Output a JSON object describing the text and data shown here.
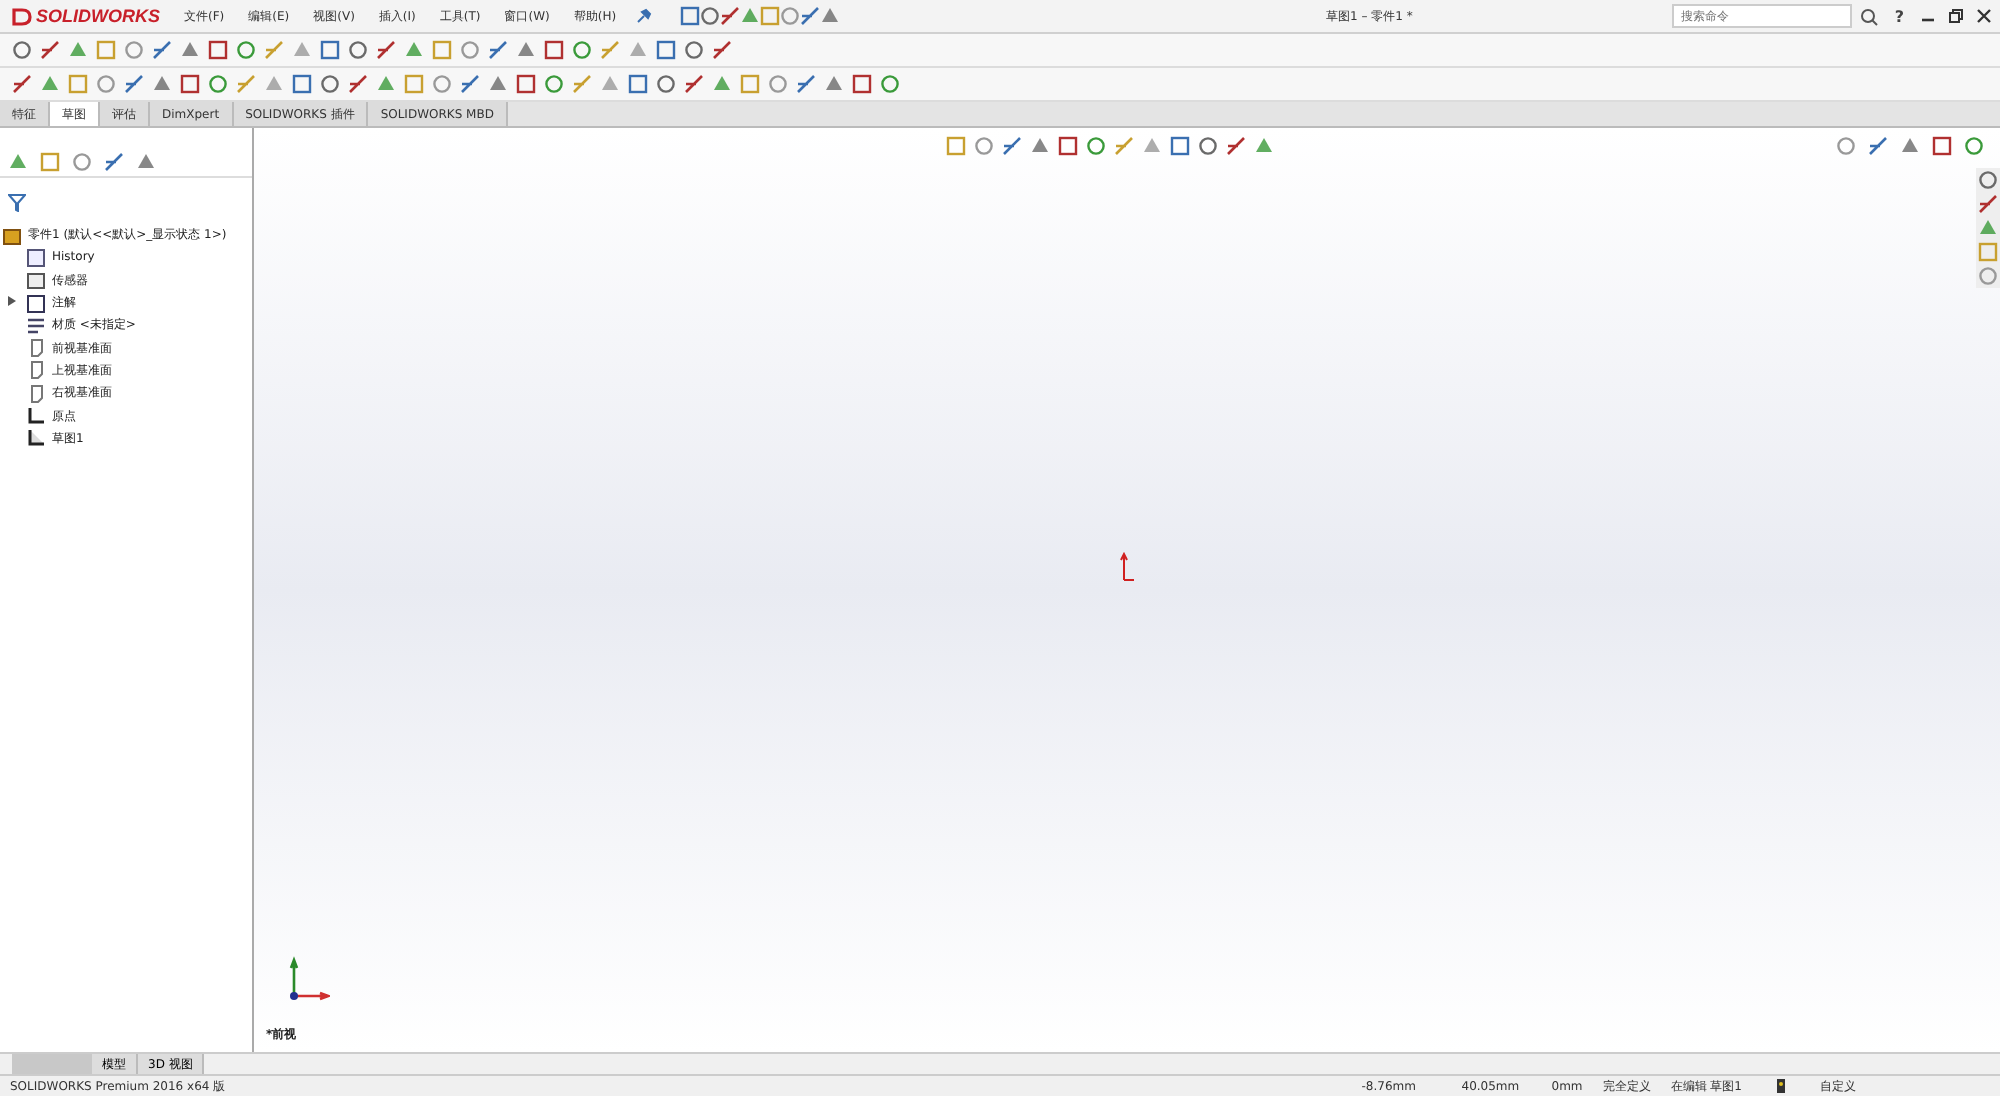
{
  "app": {
    "logo": "SOLIDWORKS",
    "menus": [
      "文件(F)",
      "编辑(E)",
      "视图(V)",
      "插入(I)",
      "工具(T)",
      "窗口(W)",
      "帮助(H)"
    ],
    "title": "草图1 – 零件1 *",
    "search": {
      "placeholder": "搜索命令"
    },
    "help": "?"
  },
  "command_tabs": [
    {
      "label": "特征",
      "selected": false
    },
    {
      "label": "草图",
      "selected": true
    },
    {
      "label": "评估",
      "selected": false
    },
    {
      "label": "DimXpert",
      "selected": false
    },
    {
      "label": "SOLIDWORKS 插件",
      "selected": false
    },
    {
      "label": "SOLIDWORKS MBD",
      "selected": false
    }
  ],
  "tree": {
    "root": {
      "label": "零件1 (默认<<默认>_显示状态 1>)",
      "children": [
        {
          "label": "History",
          "kind": "history"
        },
        {
          "label": "传感器",
          "kind": "sensor"
        },
        {
          "label": "注解",
          "kind": "annotation",
          "expanded": false
        },
        {
          "label": "材质 <未指定>",
          "kind": "material"
        },
        {
          "label": "前视基准面",
          "kind": "plane"
        },
        {
          "label": "上视基准面",
          "kind": "plane"
        },
        {
          "label": "右视基准面",
          "kind": "plane"
        },
        {
          "label": "原点",
          "kind": "origin"
        },
        {
          "label": "草图1",
          "kind": "sketch"
        }
      ]
    }
  },
  "viewport": {
    "view_name": "*前视"
  },
  "bottom_tabs": [
    {
      "label": "模型",
      "selected": false
    },
    {
      "label": "3D 视图",
      "selected": false
    }
  ],
  "status_bar": {
    "product": "SOLIDWORKS Premium 2016 x64 版",
    "x": "-8.76mm",
    "y": "40.05mm",
    "z": "0mm",
    "state": "完全定义",
    "editing": "在编辑 草图1",
    "units": "自定义"
  }
}
